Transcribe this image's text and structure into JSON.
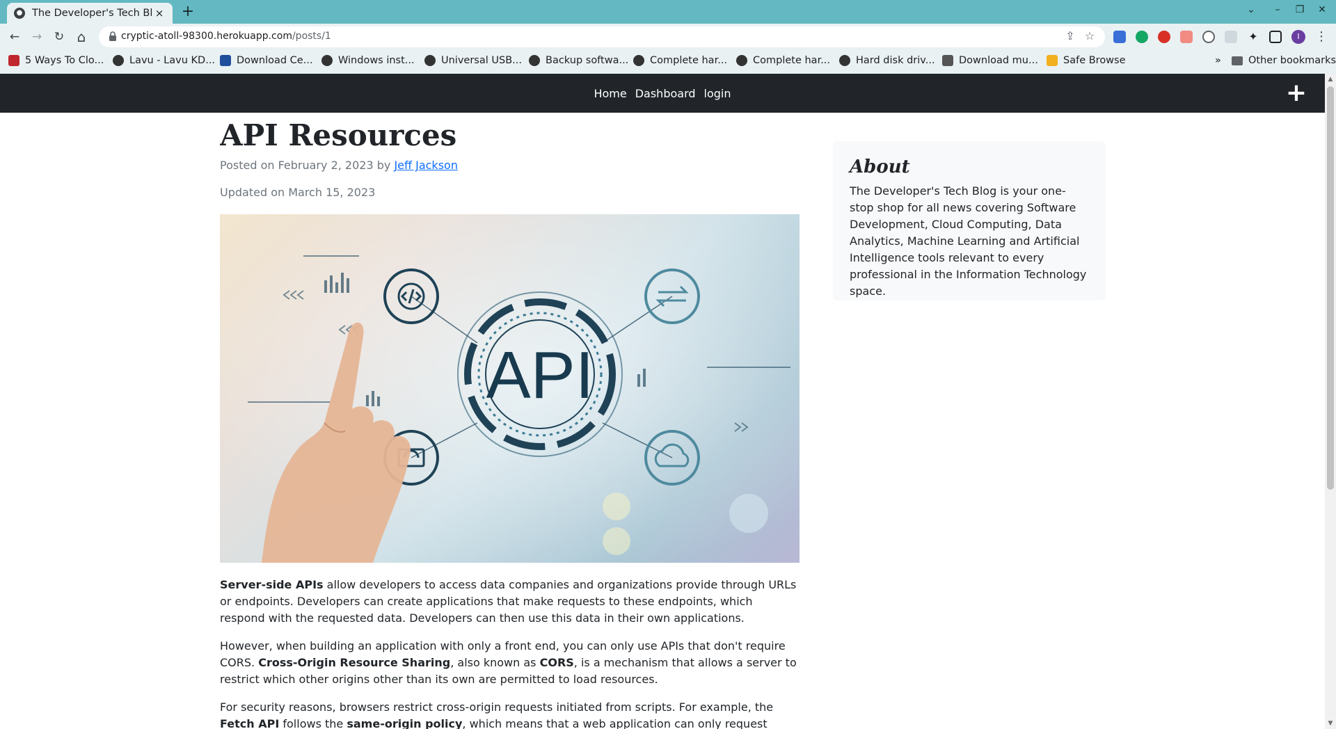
{
  "browser": {
    "tab": {
      "title": "The Developer's Tech Blog",
      "close": "×"
    },
    "new_tab": "+",
    "window_controls": {
      "tab_search": "⌄",
      "minimize": "–",
      "restore": "❐",
      "close": "✕"
    },
    "toolbar": {
      "back": "←",
      "forward": "→",
      "reload": "↻",
      "home": "⌂"
    },
    "url": {
      "host": "cryptic-atoll-98300.herokuapp.com",
      "path": "/posts/1"
    },
    "profile_initial": "I",
    "bookmarks": [
      {
        "label": "5 Ways To Clo...",
        "icon": "red-bookmark-icon",
        "color": "#c0262d"
      },
      {
        "label": "Lavu - Lavu KD...",
        "icon": "globe-icon",
        "color": "#333333"
      },
      {
        "label": "Download Ce...",
        "icon": "site-icon",
        "color": "#1f4e9b"
      },
      {
        "label": "Windows inst...",
        "icon": "globe-icon",
        "color": "#333333"
      },
      {
        "label": "Universal USB...",
        "icon": "globe-icon",
        "color": "#333333"
      },
      {
        "label": "Backup softwa...",
        "icon": "globe-icon",
        "color": "#333333"
      },
      {
        "label": "Complete har...",
        "icon": "globe-icon",
        "color": "#333333"
      },
      {
        "label": "Complete har...",
        "icon": "globe-icon",
        "color": "#333333"
      },
      {
        "label": "Hard disk driv...",
        "icon": "globe-icon",
        "color": "#333333"
      },
      {
        "label": "Download mu...",
        "icon": "site-icon",
        "color": "#555555"
      },
      {
        "label": "Safe Browse",
        "icon": "lock-bookmark-icon",
        "color": "#f2b01e"
      }
    ],
    "bookmarks_overflow": "»",
    "other_bookmarks": "Other bookmarks"
  },
  "site": {
    "nav": {
      "home": "Home",
      "dashboard": "Dashboard",
      "login": "login",
      "plus": "+"
    }
  },
  "post": {
    "title": "API Resources",
    "posted_prefix": "Posted on February 2, 2023 by",
    "author": "Jeff Jackson",
    "updated": "Updated on March 15, 2023",
    "hero_text": "API",
    "p1_b1": "Server-side APIs",
    "p1_t1": " allow developers to access data companies and organizations provide through URLs or endpoints. Developers can create applications that make requests to these endpoints, which respond with the requested data. Developers can then use this data in their own applications.",
    "p2_t1": "However, when building an application with only a front end, you can only use APIs that don't require CORS. ",
    "p2_b1": "Cross-Origin Resource Sharing",
    "p2_t2": ", also known as ",
    "p2_b2": "CORS",
    "p2_t3": ", is a mechanism that allows a server to restrict which other origins other than its own are permitted to load resources.",
    "p3_t1": "For security reasons, browsers restrict cross-origin requests initiated from scripts. For example, the ",
    "p3_b1": "Fetch API",
    "p3_t2": " follows the ",
    "p3_b2": "same-origin policy",
    "p3_t3": ", which means that a web application can only request resources from the same origin the"
  },
  "sidebar": {
    "about_title": "About",
    "about_text": "The Developer's Tech Blog is your one-stop shop for all news covering Software Development, Cloud Computing, Data Analytics, Machine Learning and Artificial Intelligence tools relevant to every professional in the Information Technology space."
  }
}
